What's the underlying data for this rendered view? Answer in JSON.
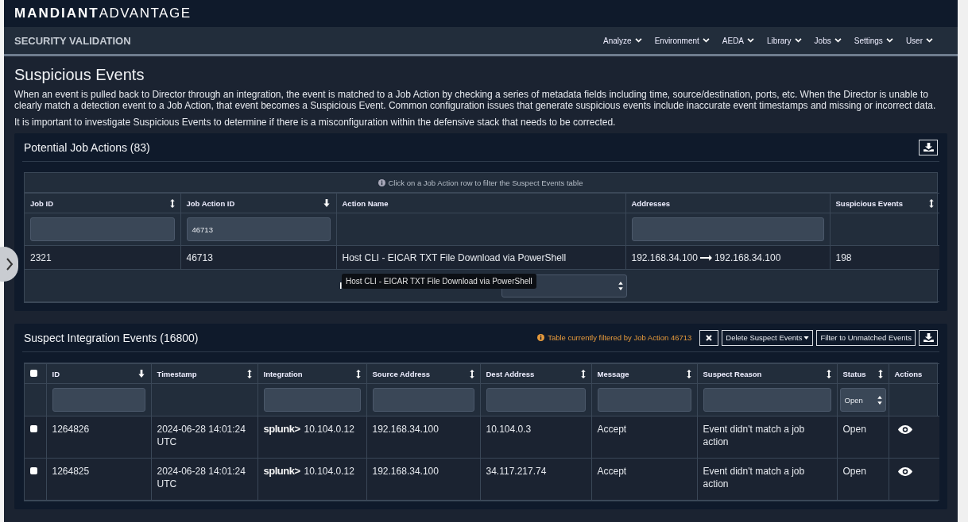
{
  "brand": {
    "bold": "MANDIANT",
    "light": "ADVANTAGE"
  },
  "nav": {
    "title": "SECURITY VALIDATION",
    "menus": [
      "Analyze",
      "Environment",
      "AEDA",
      "Library",
      "Jobs",
      "Settings",
      "User"
    ]
  },
  "page": {
    "title": "Suspicious Events",
    "paragraphs": [
      "When an event is pulled back to Director through an integration, the event is matched to a Job Action by checking a series of metadata fields including time, source/destination, ports, etc. When the Director is unable to clearly match a detection event to a Job Action, that event becomes a Suspicious Event. Common configuration issues that generate suspicious events include inaccurate event timestamps and missing or incorrect data.",
      "It is important to investigate Suspicious Events to determine if there is a misconfiguration within the defensive stack that needs to be corrected."
    ]
  },
  "job_actions": {
    "title": "Potential Job Actions (83)",
    "hint": "Click on a Job Action row to filter the Suspect Events table",
    "columns": [
      {
        "label": "Job ID",
        "sortable": true,
        "sorted": false,
        "filter": true
      },
      {
        "label": "Job Action ID",
        "sortable": true,
        "sorted": true,
        "filter": true,
        "filter_value": "46713"
      },
      {
        "label": "Action Name",
        "sortable": false,
        "filter": false
      },
      {
        "label": "Addresses",
        "sortable": false,
        "filter": true
      },
      {
        "label": "Suspicious Events",
        "sortable": true,
        "sorted": false,
        "filter": false
      }
    ],
    "rows": [
      {
        "job_id": "2321",
        "job_action_id": "46713",
        "action_name": "Host CLI - EICAR TXT File Download via PowerShell",
        "source": "192.168.34.100",
        "dest": "192.168.34.100",
        "suspicious_events": "198"
      }
    ],
    "tooltip": "Host CLI - EICAR TXT File Download via PowerShell"
  },
  "suspect_events": {
    "all_checked": false,
    "title": "Suspect Integration Events (16800)",
    "filter_note": "Table currently filtered by Job Action 46713",
    "buttons": [
      "Delete Suspect Events",
      "Filter to Unmatched Events"
    ],
    "columns": [
      {
        "label": "ID",
        "sortable": true,
        "sorted": true,
        "filter": true
      },
      {
        "label": "Timestamp",
        "sortable": true,
        "sorted": false,
        "filter": false
      },
      {
        "label": "Integration",
        "sortable": true,
        "sorted": false,
        "filter": true
      },
      {
        "label": "Source Address",
        "sortable": true,
        "sorted": false,
        "filter": true
      },
      {
        "label": "Dest Address",
        "sortable": true,
        "sorted": false,
        "filter": true
      },
      {
        "label": "Message",
        "sortable": true,
        "sorted": false,
        "filter": true
      },
      {
        "label": "Suspect Reason",
        "sortable": true,
        "sorted": false,
        "filter": true
      },
      {
        "label": "Status",
        "sortable": true,
        "sorted": false,
        "filter": true,
        "filter_value": "Open"
      },
      {
        "label": "Actions",
        "sortable": false,
        "filter": false
      }
    ],
    "rows": [
      {
        "checked": false,
        "id": "1264826",
        "timestamp": "2024-06-28 14:01:24 UTC",
        "integration_logo": "splunk>",
        "integration_host": "10.104.0.12",
        "source": "192.168.34.100",
        "dest": "10.104.0.3",
        "message": "Accept",
        "reason": "Event didn't match a job action",
        "status": "Open"
      },
      {
        "checked": false,
        "id": "1264825",
        "timestamp": "2024-06-28 14:01:24 UTC",
        "integration_logo": "splunk>",
        "integration_host": "10.104.0.12",
        "source": "192.168.34.100",
        "dest": "34.117.217.74",
        "message": "Accept",
        "reason": "Event didn't match a job action",
        "status": "Open"
      }
    ]
  }
}
